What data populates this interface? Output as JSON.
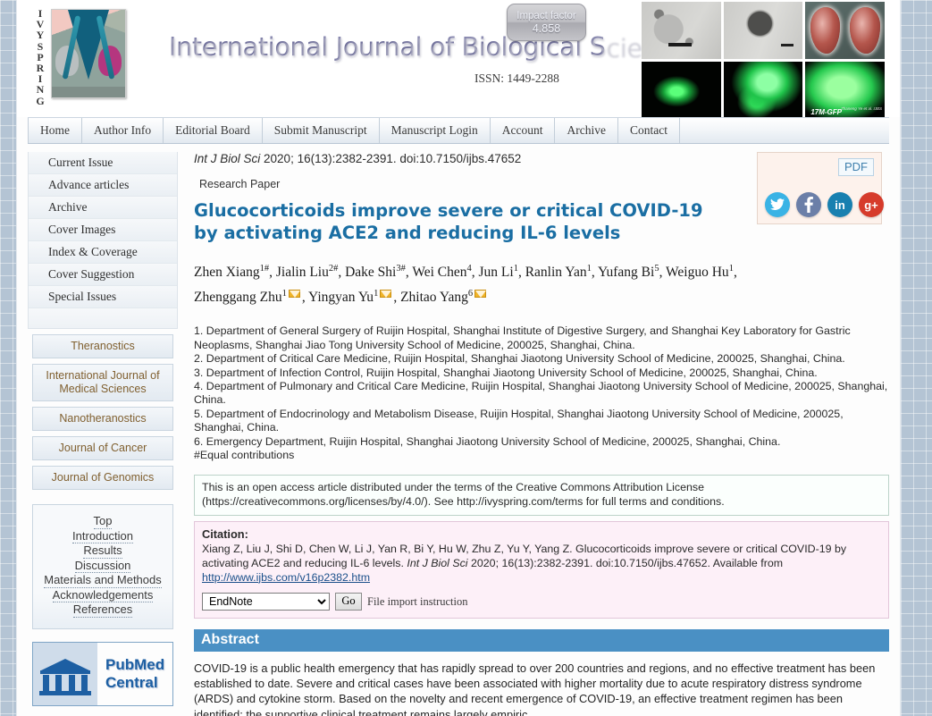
{
  "masthead": {
    "logo_word": "IVYSPRING",
    "journal_title": "International Journal of Biological Sciences",
    "issn": "ISSN: 1449-2288",
    "impact_label": "Impact factor",
    "impact_value": "4.858",
    "gallery_label": "17M-GFP",
    "gallery_credit": "Zhaneng Ye et al. IJBS"
  },
  "nav": {
    "items": [
      {
        "label": "Home"
      },
      {
        "label": "Author Info"
      },
      {
        "label": "Editorial Board"
      },
      {
        "label": "Submit Manuscript"
      },
      {
        "label": "Manuscript Login"
      },
      {
        "label": "Account"
      },
      {
        "label": "Archive"
      },
      {
        "label": "Contact"
      }
    ]
  },
  "sidebar": {
    "links": [
      {
        "label": "Current Issue"
      },
      {
        "label": "Advance articles"
      },
      {
        "label": "Archive"
      },
      {
        "label": "Cover Images"
      },
      {
        "label": "Index & Coverage"
      },
      {
        "label": "Cover Suggestion"
      },
      {
        "label": "Special Issues"
      }
    ],
    "journals": [
      {
        "label": "Theranostics"
      },
      {
        "label": "International Journal of Medical Sciences"
      },
      {
        "label": "Nanotheranostics"
      },
      {
        "label": "Journal of Cancer"
      },
      {
        "label": "Journal of Genomics"
      }
    ],
    "toc": [
      {
        "label": "Top"
      },
      {
        "label": "Introduction"
      },
      {
        "label": "Results"
      },
      {
        "label": "Discussion"
      },
      {
        "label": "Materials and Methods"
      },
      {
        "label": "Acknowledgements"
      },
      {
        "label": "References"
      }
    ],
    "pubmed": {
      "line1": "PubMed",
      "line2": "Central"
    }
  },
  "article": {
    "journal_abbrev": "Int J Biol Sci",
    "citation_line_rest": " 2020; 16(13):2382-2391. doi:10.7150/ijbs.47652",
    "paper_type": "Research Paper",
    "title": "Glucocorticoids improve severe or critical COVID-19 by activating ACE2 and reducing IL-6 levels",
    "authors_segments": [
      {
        "name": "Zhen Xiang",
        "sup": "1#",
        "mail": false
      },
      {
        "name": ", Jialin Liu",
        "sup": "2#",
        "mail": false
      },
      {
        "name": ", Dake Shi",
        "sup": "3#",
        "mail": false
      },
      {
        "name": ", Wei Chen",
        "sup": "4",
        "mail": false
      },
      {
        "name": ", Jun Li",
        "sup": "1",
        "mail": false
      },
      {
        "name": ", Ranlin Yan",
        "sup": "1",
        "mail": false
      },
      {
        "name": ", Yufang Bi",
        "sup": "5",
        "mail": false
      },
      {
        "name": ", Weiguo Hu",
        "sup": "1",
        "mail": false
      },
      {
        "name": ", Zhenggang Zhu",
        "sup": "1",
        "mail": true
      },
      {
        "name": ", Yingyan Yu",
        "sup": "1",
        "mail": true
      },
      {
        "name": ", Zhitao Yang",
        "sup": "6",
        "mail": true
      }
    ],
    "affiliations": [
      "1. Department of General Surgery of Ruijin Hospital, Shanghai Institute of Digestive Surgery, and Shanghai Key Laboratory for Gastric Neoplasms, Shanghai Jiao Tong University School of Medicine, 200025, Shanghai, China.",
      "2. Department of Critical Care Medicine, Ruijin Hospital, Shanghai Jiaotong University School of Medicine, 200025, Shanghai, China.",
      "3. Department of Infection Control, Ruijin Hospital, Shanghai Jiaotong University School of Medicine, 200025, Shanghai, China.",
      "4. Department of Pulmonary and Critical Care Medicine, Ruijin Hospital, Shanghai Jiaotong University School of Medicine, 200025, Shanghai, China.",
      "5. Department of Endocrinology and Metabolism Disease, Ruijin Hospital, Shanghai Jiaotong University School of Medicine, 200025, Shanghai, China.",
      "6. Emergency Department, Ruijin Hospital, Shanghai Jiaotong University School of Medicine, 200025, Shanghai, China.",
      "#Equal contributions"
    ],
    "license": "This is an open access article distributed under the terms of the Creative Commons Attribution License (https://creativecommons.org/licenses/by/4.0/). See http://ivyspring.com/terms for full terms and conditions.",
    "citation_heading": "Citation:",
    "citation_body_1": "Xiang Z, Liu J, Shi D, Chen W, Li J, Yan R, Bi Y, Hu W, Zhu Z, Yu Y, Yang Z. Glucocorticoids improve severe or critical COVID-19 by activating ACE2 and reducing IL-6 levels. ",
    "citation_journal": "Int J Biol Sci",
    "citation_body_2": " 2020; 16(13):2382-2391. doi:10.7150/ijbs.47652. Available from ",
    "citation_url": "http://www.ijbs.com/v16p2382.htm",
    "export_format": "EndNote",
    "export_options": [
      "EndNote"
    ],
    "go_label": "Go",
    "import_note": "File import instruction",
    "abstract_heading": "Abstract",
    "abstract_text": "COVID-19 is a public health emergency that has rapidly spread to over 200 countries and regions, and no effective treatment has been established to date. Severe and critical cases have been associated with higher mortality due to acute respiratory distress syndrome (ARDS) and cytokine storm. Based on the novelty and recent emergence of COVID-19, an effective treatment regimen has been identified; the supportive clinical treatment remains largely empiric."
  },
  "share": {
    "pdf_label": "PDF",
    "twitter": "twitter-icon",
    "facebook": "facebook-icon",
    "linkedin": "linkedin-icon",
    "googleplus": "googleplus-icon",
    "gplus_label": "g+",
    "fb_label": "f",
    "li_label": "in"
  },
  "colors": {
    "accent_blue": "#1a6ea3",
    "abstract_bar": "#4a90c4",
    "journal_btn_text": "#806030",
    "page_bg": "#b4c4d4"
  }
}
